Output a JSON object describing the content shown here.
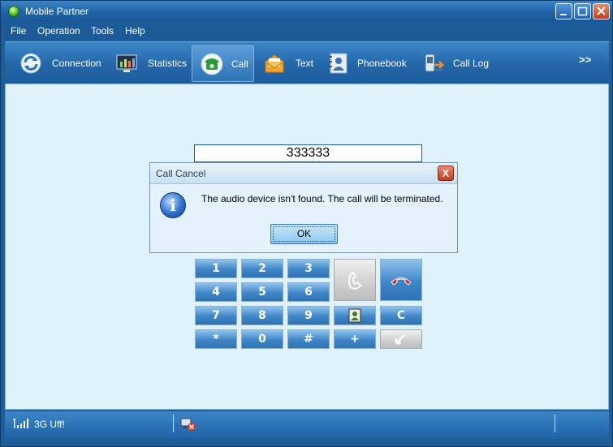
{
  "window": {
    "title": "Mobile Partner"
  },
  "menubar": {
    "items": [
      "File",
      "Operation",
      "Tools",
      "Help"
    ]
  },
  "toolbar": {
    "items": [
      {
        "label": "Connection",
        "icon": "connection-icon"
      },
      {
        "label": "Statistics",
        "icon": "statistics-icon"
      },
      {
        "label": "Call",
        "icon": "phone-icon",
        "active": true
      },
      {
        "label": "Text",
        "icon": "envelope-icon"
      },
      {
        "label": "Phonebook",
        "icon": "phonebook-icon"
      },
      {
        "label": "Call Log",
        "icon": "call-log-icon"
      }
    ],
    "more_label": ">>"
  },
  "dialer": {
    "number": "333333",
    "keys": [
      "1",
      "2",
      "3",
      "4",
      "5",
      "6",
      "7",
      "8",
      "9",
      "*",
      "0",
      "#",
      "+",
      "C"
    ]
  },
  "dialog": {
    "title": "Call Cancel",
    "message": "The audio device isn't found. The call will be terminated.",
    "ok_label": "OK",
    "close_label": "X",
    "info_glyph": "i"
  },
  "status": {
    "network_text": "3G  Uff!"
  },
  "colors": {
    "frame": "#1f5d98",
    "content_bg": "#dff1fb",
    "key_blue": "#3f86c8",
    "close_red": "#c7391b"
  }
}
